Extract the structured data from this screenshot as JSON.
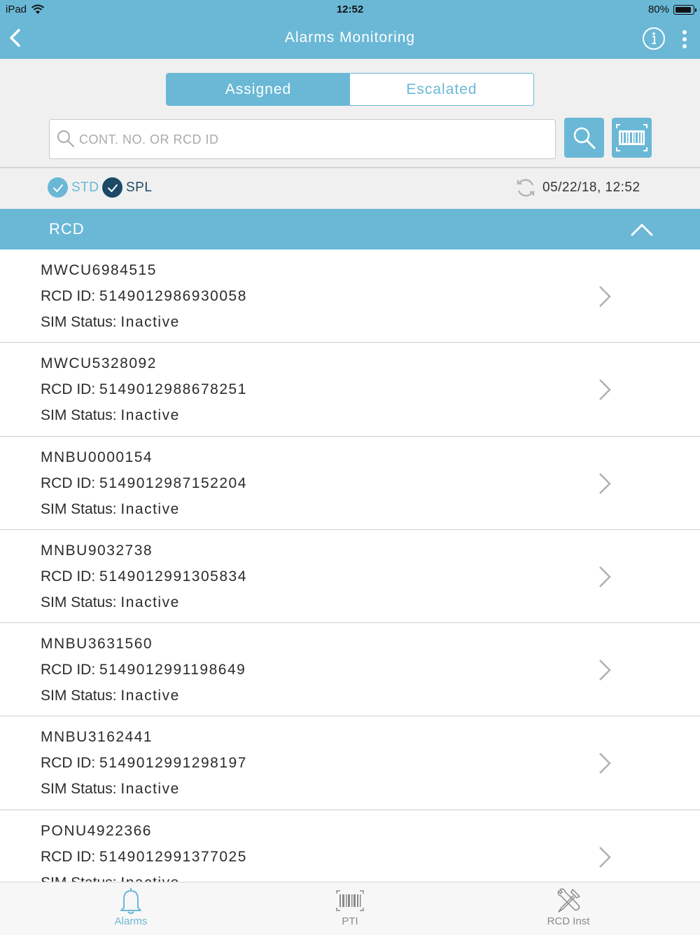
{
  "status_bar": {
    "device": "iPad",
    "time": "12:52",
    "battery": "80%"
  },
  "header": {
    "title": "Alarms Monitoring"
  },
  "segments": {
    "assigned": "Assigned",
    "escalated": "Escalated",
    "selected": "Assigned"
  },
  "search": {
    "placeholder": "CONT. NO. OR RCD ID",
    "value": ""
  },
  "filters": {
    "std": "STD",
    "spl": "SPL",
    "std_checked": true,
    "spl_checked": true
  },
  "last_updated": "05/22/18, 12:52",
  "section": {
    "title": "RCD"
  },
  "labels": {
    "rcd_id": "RCD ID:",
    "sim_status": "SIM Status:"
  },
  "items": [
    {
      "container": "MWCU6984515",
      "rcd_id": "5149012986930058",
      "sim_status": "Inactive"
    },
    {
      "container": "MWCU5328092",
      "rcd_id": "5149012988678251",
      "sim_status": "Inactive"
    },
    {
      "container": "MNBU0000154",
      "rcd_id": "5149012987152204",
      "sim_status": "Inactive"
    },
    {
      "container": "MNBU9032738",
      "rcd_id": "5149012991305834",
      "sim_status": "Inactive"
    },
    {
      "container": "MNBU3631560",
      "rcd_id": "5149012991198649",
      "sim_status": "Inactive"
    },
    {
      "container": "MNBU3162441",
      "rcd_id": "5149012991298197",
      "sim_status": "Inactive"
    },
    {
      "container": "PONU4922366",
      "rcd_id": "5149012991377025",
      "sim_status": "Inactive"
    }
  ],
  "tabs": {
    "alarms": "Alarms",
    "pti": "PTI",
    "rcd_inst": "RCD Inst",
    "active": "Alarms"
  },
  "colors": {
    "primary": "#6ab8d6",
    "dark_accent": "#1c4a66",
    "background": "#f0f0f0"
  }
}
